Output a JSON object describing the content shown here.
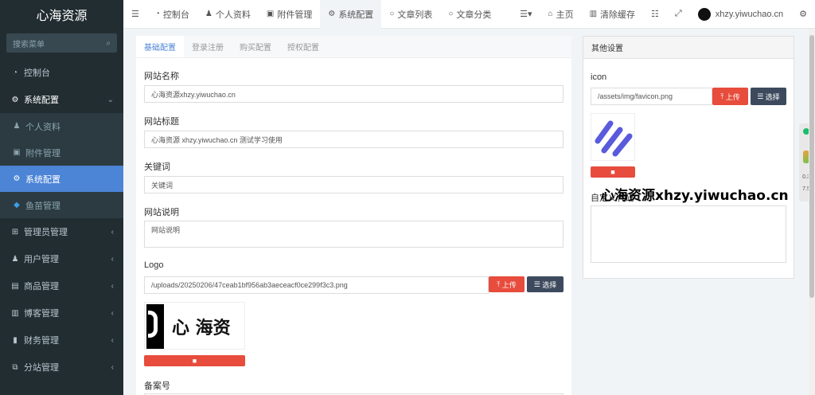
{
  "app": {
    "brand": "心海资源"
  },
  "sidebar": {
    "search_placeholder": "搜索菜单",
    "items": [
      {
        "label": "控制台",
        "icon": "dashboard-icon"
      },
      {
        "label": "系统配置",
        "icon": "cogs-icon"
      }
    ],
    "submenu": [
      {
        "label": "个人资料",
        "icon": "user-icon"
      },
      {
        "label": "附件管理",
        "icon": "image-icon"
      },
      {
        "label": "系统配置",
        "icon": "cog-icon",
        "active": true
      },
      {
        "label": "鱼苗管理",
        "icon": "fish-icon"
      }
    ],
    "groups": [
      {
        "label": "管理员管理",
        "icon": "windows-icon"
      },
      {
        "label": "用户管理",
        "icon": "user-icon"
      },
      {
        "label": "商品管理",
        "icon": "cart-icon"
      },
      {
        "label": "博客管理",
        "icon": "book-icon"
      },
      {
        "label": "财务管理",
        "icon": "bookmark-icon"
      },
      {
        "label": "分站管理",
        "icon": "clone-icon"
      }
    ]
  },
  "topbar": {
    "tabs": [
      {
        "label": "控制台",
        "icon": "dashboard-icon"
      },
      {
        "label": "个人资料",
        "icon": "user-icon"
      },
      {
        "label": "附件管理",
        "icon": "image-icon"
      },
      {
        "label": "系统配置",
        "icon": "cog-icon",
        "active": true
      },
      {
        "label": "文章列表",
        "icon": "circle-icon"
      },
      {
        "label": "文章分类",
        "icon": "circle-icon"
      }
    ],
    "home": "主页",
    "clear_cache": "清除缓存",
    "username": "xhzy.yiwuchao.cn"
  },
  "config": {
    "tabs": [
      "基础配置",
      "登录注册",
      "购买配置",
      "授权配置"
    ],
    "site_name_label": "网站名称",
    "site_name_value": "心海资源xhzy.yiwuchao.cn",
    "site_title_label": "网站标题",
    "site_title_value": "心海资源 xhzy.yiwuchao.cn 测试学习使用",
    "keywords_label": "关键词",
    "keywords_placeholder": "关键词",
    "description_label": "网站说明",
    "description_placeholder": "网站说明",
    "logo_label": "Logo",
    "logo_value": "/uploads/20250206/47ceab1bf956ab3aeceacf0ce299f3c3.png",
    "logo_image_text": "心 海资",
    "upload_label": "上传",
    "choose_label": "选择",
    "beian_label": "备案号"
  },
  "other": {
    "title": "其他设置",
    "icon_label": "icon",
    "icon_value": "/assets/img/favicon.png",
    "upload_label": "上传",
    "choose_label": "选择",
    "custom_label": "自定义代码"
  },
  "side_widget": {
    "value1": "0.3",
    "value2": "7.5"
  },
  "watermark": "心海资源xhzy.yiwuchao.cn"
}
